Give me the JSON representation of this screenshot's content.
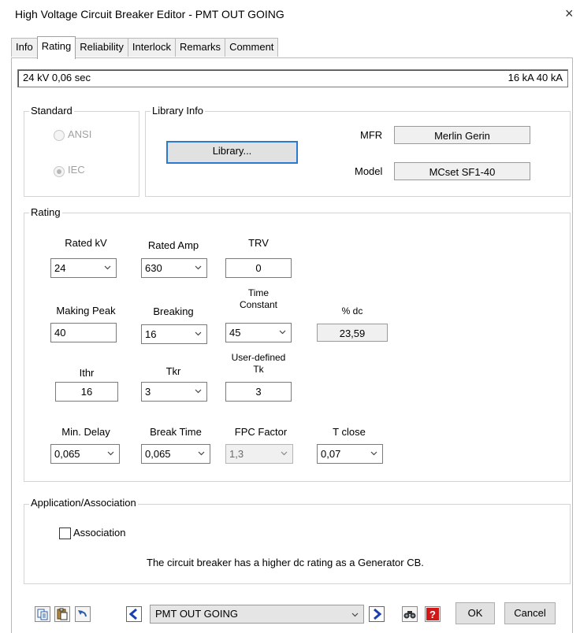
{
  "window": {
    "title": "High Voltage Circuit Breaker Editor - PMT OUT GOING",
    "close_glyph": "×"
  },
  "tabs": [
    "Info",
    "Rating",
    "Reliability",
    "Interlock",
    "Remarks",
    "Comment"
  ],
  "active_tab": "Rating",
  "status": {
    "left": "24 kV  0,06 sec",
    "right": "16 kA  40 kA"
  },
  "standard": {
    "label": "Standard",
    "options": [
      "ANSI",
      "IEC"
    ],
    "selected": "IEC"
  },
  "library_info": {
    "label": "Library Info",
    "button": "Library...",
    "mfr_label": "MFR",
    "mfr_value": "Merlin Gerin",
    "model_label": "Model",
    "model_value": "MCset SF1-40"
  },
  "rating": {
    "label": "Rating",
    "rated_kv": {
      "label": "Rated kV",
      "value": "24"
    },
    "rated_amp": {
      "label": "Rated Amp",
      "value": "630"
    },
    "trv": {
      "label": "TRV",
      "value": "0"
    },
    "making_peak": {
      "label": "Making Peak",
      "value": "40"
    },
    "breaking": {
      "label": "Breaking",
      "value": "16"
    },
    "time_constant": {
      "label_1": "Time",
      "label_2": "Constant",
      "value": "45"
    },
    "pct_dc": {
      "label": "% dc",
      "value": "23,59"
    },
    "ithr": {
      "label": "Ithr",
      "value": "16"
    },
    "tkr": {
      "label": "Tkr",
      "value": "3"
    },
    "user_tk": {
      "label_1": "User-defined",
      "label_2": "Tk",
      "value": "3"
    },
    "min_delay": {
      "label": "Min. Delay",
      "value": "0,065"
    },
    "break_time": {
      "label": "Break Time",
      "value": "0,065"
    },
    "fpc_factor": {
      "label": "FPC Factor",
      "value": "1,3"
    },
    "t_close": {
      "label": "T close",
      "value": "0,07"
    }
  },
  "application": {
    "label": "Application/Association",
    "checkbox_label": "Association",
    "checked": false,
    "message": "The circuit breaker has a higher dc rating as a Generator CB."
  },
  "footer": {
    "nav_value": "PMT OUT GOING",
    "ok": "OK",
    "cancel": "Cancel",
    "icons": [
      "copy-icon",
      "paste-icon",
      "undo-icon",
      "previous-icon",
      "next-icon",
      "find-icon",
      "help-icon"
    ]
  }
}
